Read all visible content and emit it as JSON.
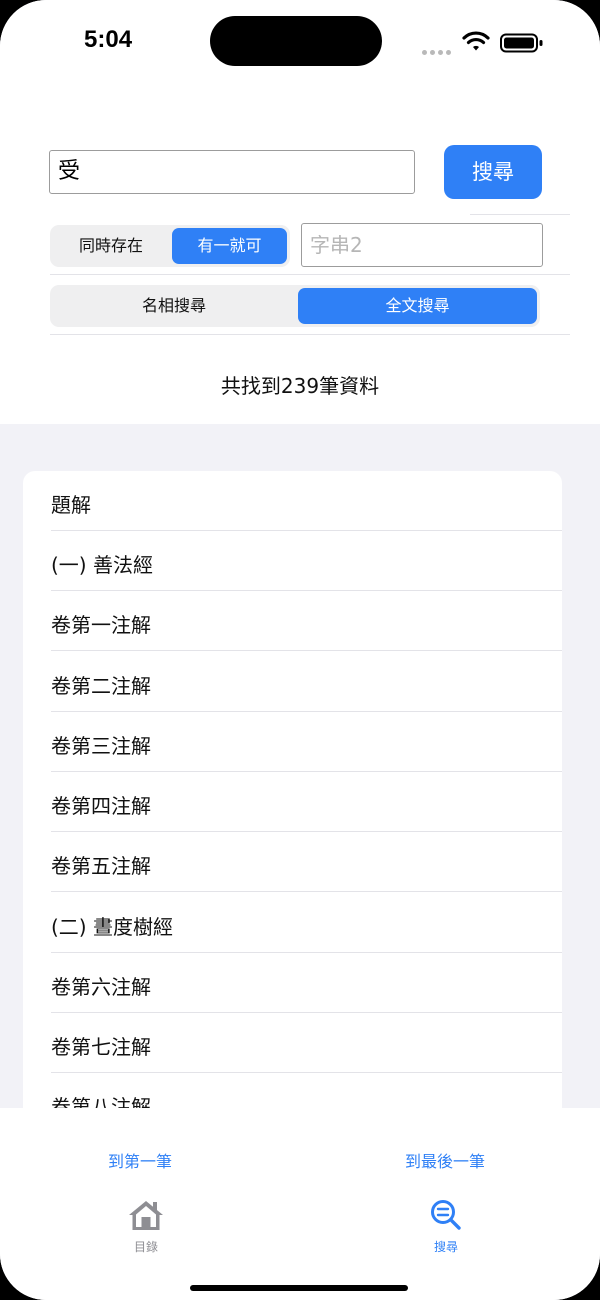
{
  "status_bar": {
    "time": "5:04"
  },
  "search": {
    "query": "受",
    "button_label": "搜尋"
  },
  "match_mode": {
    "options": [
      "同時存在",
      "有一就可"
    ],
    "selected": "有一就可"
  },
  "string2": {
    "placeholder": "字串2"
  },
  "search_scope": {
    "options": [
      "名相搜尋",
      "全文搜尋"
    ],
    "selected": "全文搜尋"
  },
  "result_count": "共找到239筆資料",
  "results": [
    "題解",
    "(一) 善法經",
    "卷第一注解",
    "卷第二注解",
    "卷第三注解",
    "卷第四注解",
    "卷第五注解",
    "(二) 晝度樹經",
    "卷第六注解",
    "卷第七注解",
    "卷第八注解"
  ],
  "nav": {
    "first": "到第一筆",
    "last": "到最後一筆"
  },
  "tabs": [
    {
      "label": "目錄",
      "icon": "house-icon",
      "active": false
    },
    {
      "label": "搜尋",
      "icon": "search-magnifier-icon",
      "active": true
    }
  ],
  "colors": {
    "accent": "#2f80f6",
    "background": "#f2f2f7",
    "inactive_tab": "#8e8e93"
  }
}
